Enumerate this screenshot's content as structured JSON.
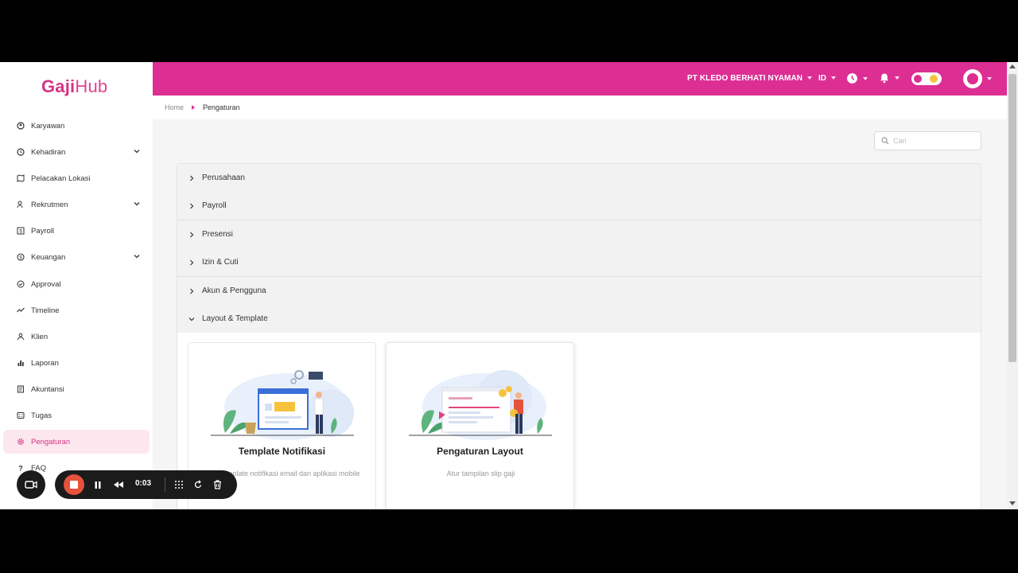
{
  "app": {
    "logo_main": "Gaji",
    "logo_sub": "Hub"
  },
  "sidebar": {
    "items": [
      {
        "label": "Karyawan",
        "icon": "users-icon"
      },
      {
        "label": "Kehadiran",
        "icon": "clock-history-icon",
        "expandable": true
      },
      {
        "label": "Pelacakan Lokasi",
        "icon": "map-icon"
      },
      {
        "label": "Rekrutmen",
        "icon": "person-search-icon",
        "expandable": true
      },
      {
        "label": "Payroll",
        "icon": "payroll-icon"
      },
      {
        "label": "Keuangan",
        "icon": "dollar-icon",
        "expandable": true
      },
      {
        "label": "Approval",
        "icon": "check-circle-icon"
      },
      {
        "label": "Timeline",
        "icon": "timeline-icon"
      },
      {
        "label": "Klien",
        "icon": "client-icon"
      },
      {
        "label": "Laporan",
        "icon": "bar-chart-icon"
      },
      {
        "label": "Akuntansi",
        "icon": "book-icon"
      },
      {
        "label": "Tugas",
        "icon": "task-icon"
      },
      {
        "label": "Pengaturan",
        "icon": "gear-icon",
        "active": true
      },
      {
        "label": "FAQ",
        "icon": "question-icon"
      }
    ]
  },
  "topbar": {
    "company": "PT KLEDO BERHATI NYAMAN",
    "language": "ID",
    "accent_color": "#dd2e94"
  },
  "breadcrumb": {
    "home": "Home",
    "current": "Pengaturan"
  },
  "search": {
    "placeholder": "Cari",
    "value": ""
  },
  "accordion": {
    "sections": [
      {
        "label": "Perusahaan",
        "expanded": false
      },
      {
        "label": "Payroll",
        "expanded": false
      },
      {
        "label": "Presensi",
        "expanded": false
      },
      {
        "label": "Izin & Cuti",
        "expanded": false
      },
      {
        "label": "Akun & Pengguna",
        "expanded": false
      },
      {
        "label": "Layout & Template",
        "expanded": true
      }
    ],
    "cards": [
      {
        "title": "Template Notifikasi",
        "desc": "Atur template notifikasi email dan aplikasi mobile"
      },
      {
        "title": "Pengaturan Layout",
        "desc": "Atur tampilan slip gaji"
      }
    ]
  },
  "recorder": {
    "time": "0:03"
  }
}
